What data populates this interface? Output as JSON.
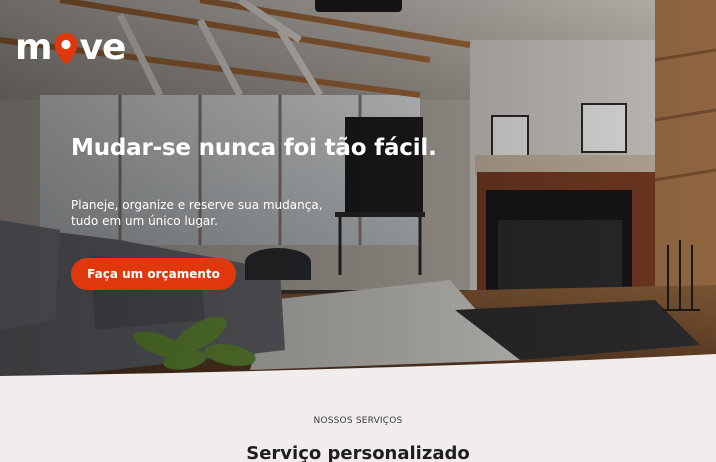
{
  "brand": {
    "logo_before": "m",
    "logo_after": "ve",
    "accent_color": "#e0380c"
  },
  "hero": {
    "headline": "Mudar-se nunca foi tão fácil.",
    "subtext": "Planeje, organize e reserve sua mudança, tudo em um único lugar.",
    "cta_label": "Faça um orçamento",
    "background_image": "living-room-with-fireplace"
  },
  "services": {
    "eyebrow": "NOSSOS SERVIÇOS",
    "title": "Serviço personalizado"
  }
}
